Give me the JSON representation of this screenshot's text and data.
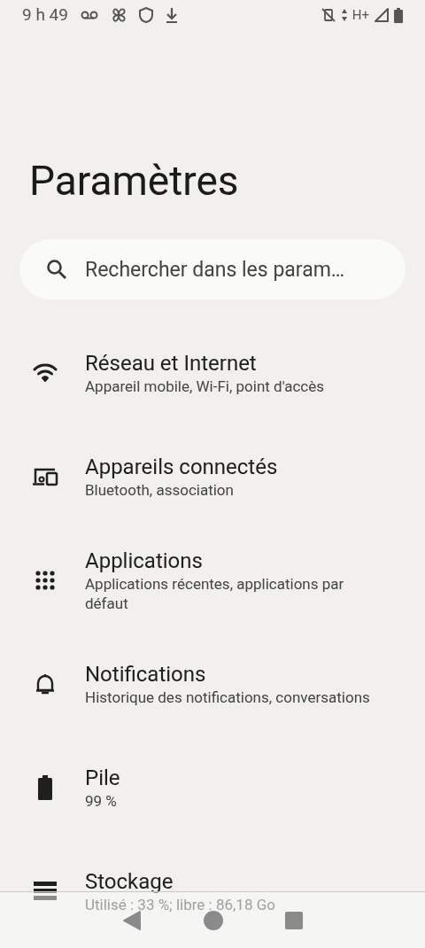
{
  "status_bar": {
    "time": "9 h 49",
    "network": "H+"
  },
  "title": "Paramètres",
  "search": {
    "placeholder": "Rechercher dans les param…"
  },
  "items": [
    {
      "kind": "wifi",
      "title": "Réseau et Internet",
      "subtitle": "Appareil mobile, Wi-Fi, point d'accès"
    },
    {
      "kind": "devices",
      "title": "Appareils connectés",
      "subtitle": "Bluetooth, association"
    },
    {
      "kind": "apps",
      "title": "Applications",
      "subtitle": "Applications récentes, applications par défaut"
    },
    {
      "kind": "bell",
      "title": "Notifications",
      "subtitle": "Historique des notifications, conversations"
    },
    {
      "kind": "battery",
      "title": "Pile",
      "subtitle": "99 %"
    },
    {
      "kind": "storage",
      "title": "Stockage",
      "subtitle": "Utilisé : 33 %; libre : 86,18 Go"
    }
  ]
}
